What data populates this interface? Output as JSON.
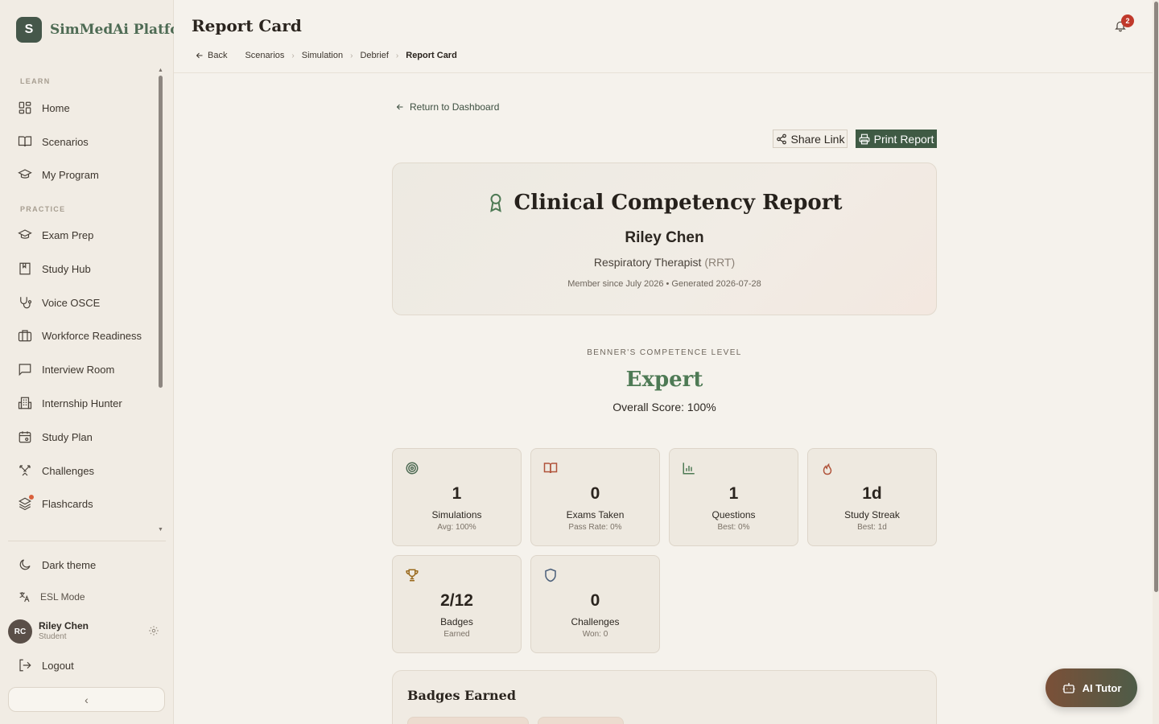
{
  "brand": {
    "logo_letter": "S",
    "name": "SimMedAi Platform"
  },
  "sidebar": {
    "sections": [
      {
        "label": "LEARN",
        "items": [
          {
            "label": "Home",
            "icon": "grid-icon"
          },
          {
            "label": "Scenarios",
            "icon": "book-open-icon"
          },
          {
            "label": "My Program",
            "icon": "graduation-cap-icon"
          }
        ]
      },
      {
        "label": "PRACTICE",
        "items": [
          {
            "label": "Exam Prep",
            "icon": "graduation-cap-icon"
          },
          {
            "label": "Study Hub",
            "icon": "book-marked-icon"
          },
          {
            "label": "Voice OSCE",
            "icon": "stethoscope-icon"
          },
          {
            "label": "Workforce Readiness",
            "icon": "briefcase-icon"
          },
          {
            "label": "Interview Room",
            "icon": "message-square-icon"
          },
          {
            "label": "Internship Hunter",
            "icon": "building-icon"
          },
          {
            "label": "Study Plan",
            "icon": "calendar-icon"
          },
          {
            "label": "Challenges",
            "icon": "swords-icon"
          },
          {
            "label": "Flashcards",
            "icon": "layers-icon"
          }
        ]
      }
    ],
    "bottom": {
      "dark_theme": "Dark theme",
      "esl_mode": "ESL Mode",
      "logout": "Logout"
    },
    "user": {
      "initials": "RC",
      "name": "Riley Chen",
      "role": "Student"
    },
    "collapse_glyph": "‹"
  },
  "header": {
    "title": "Report Card",
    "back": "Back",
    "breadcrumbs": [
      "Scenarios",
      "Simulation",
      "Debrief",
      "Report Card"
    ],
    "notifications": "2"
  },
  "main": {
    "return_link": "Return to Dashboard",
    "share_label": "Share Link",
    "print_label": "Print Report",
    "report": {
      "title": "Clinical Competency Report",
      "name": "Riley Chen",
      "role": "Respiratory Therapist",
      "role_abbr": "(RRT)",
      "meta": "Member since July 2026 • Generated 2026-07-28"
    },
    "benner": {
      "label": "BENNER'S COMPETENCE LEVEL",
      "level": "Expert",
      "overall": "Overall Score: 100%"
    },
    "stats": [
      {
        "icon": "target-icon",
        "value": "1",
        "label": "Simulations",
        "sub": "Avg: 100%"
      },
      {
        "icon": "book-open-icon",
        "value": "0",
        "label": "Exams Taken",
        "sub": "Pass Rate: 0%"
      },
      {
        "icon": "bar-chart-icon",
        "value": "1",
        "label": "Questions",
        "sub": "Best: 0%"
      },
      {
        "icon": "flame-icon",
        "value": "1d",
        "label": "Study Streak",
        "sub": "Best: 1d"
      },
      {
        "icon": "trophy-icon",
        "value": "2/12",
        "label": "Badges",
        "sub": "Earned"
      },
      {
        "icon": "shield-icon",
        "value": "0",
        "label": "Challenges",
        "sub": "Won: 0"
      }
    ],
    "badges_title": "Badges Earned"
  },
  "ai_tutor": "AI Tutor",
  "colors": {
    "accent": "#3f5a44",
    "expert": "#4e7a55",
    "badge": "#c0392b",
    "bg": "#f5f2ec"
  }
}
